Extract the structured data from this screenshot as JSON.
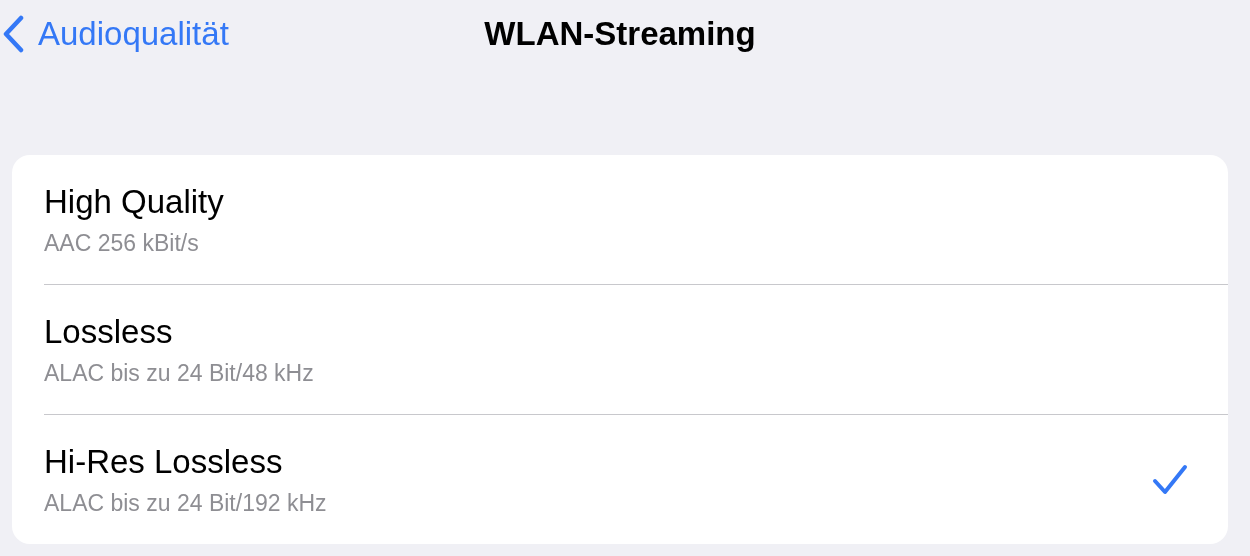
{
  "nav": {
    "back_label": "Audioqualität",
    "title": "WLAN-Streaming"
  },
  "options": [
    {
      "title": "High Quality",
      "subtitle": "AAC 256 kBit/s",
      "selected": false
    },
    {
      "title": "Lossless",
      "subtitle": "ALAC bis zu 24 Bit/48 kHz",
      "selected": false
    },
    {
      "title": "Hi-Res Lossless",
      "subtitle": "ALAC bis zu 24 Bit/192 kHz",
      "selected": true
    }
  ]
}
